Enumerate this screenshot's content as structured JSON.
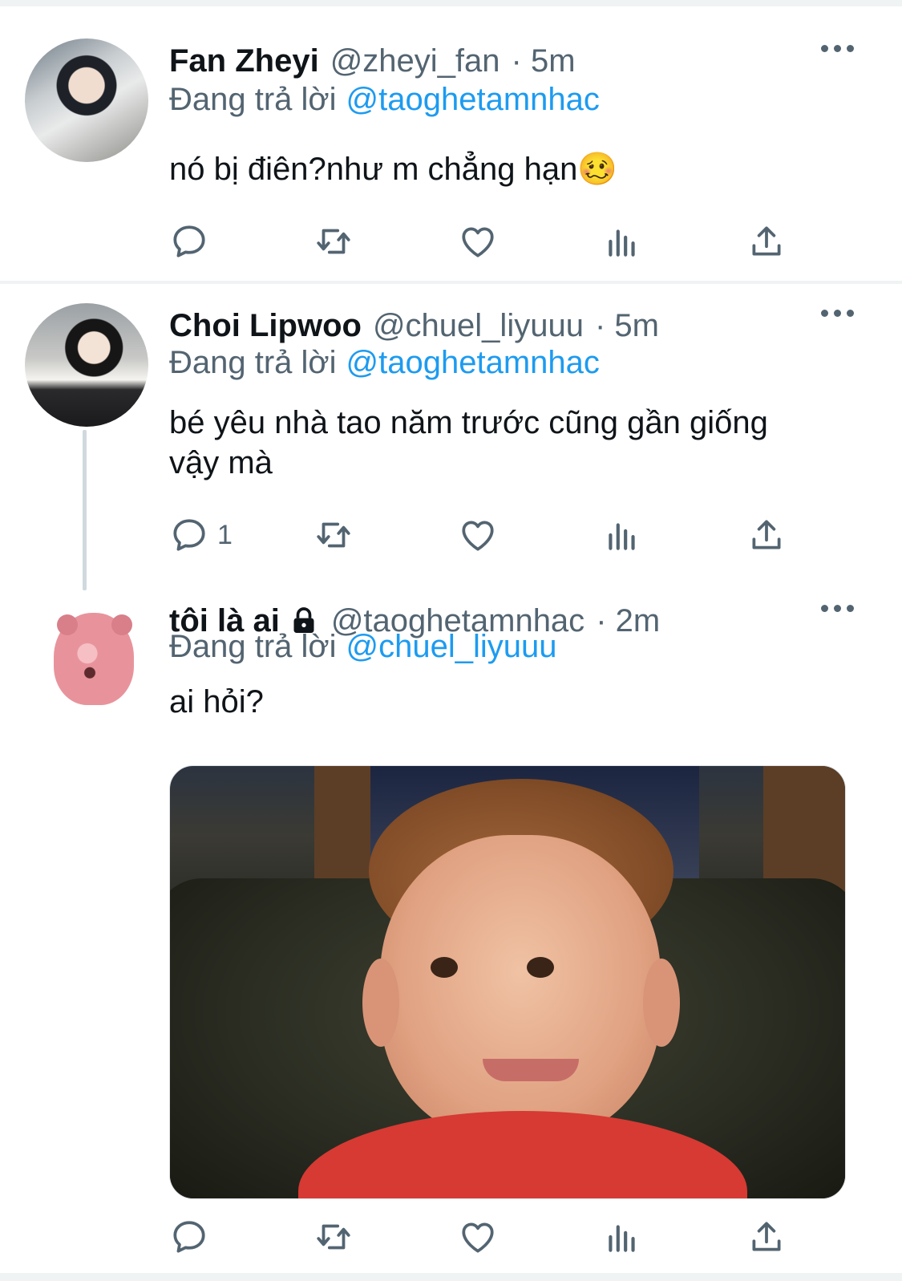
{
  "tweets": [
    {
      "name": "Fan Zheyi",
      "handle": "@zheyi_fan",
      "time": "· 5m",
      "reply_prefix": "Đang trả lời",
      "reply_to": "@taoghetamnhac",
      "text": "nó bị điên?như m chẳng hạn🥴",
      "reply_count": "",
      "avatar_icon": "avatar-photo"
    },
    {
      "name": "Choi Lipwoo",
      "handle": "@chuel_liyuuu",
      "time": "· 5m",
      "reply_prefix": "Đang trả lời",
      "reply_to": "@taoghetamnhac",
      "text_line1": "bé yêu nhà tao năm trước cũng gần giống",
      "text_line2": "vậy mà",
      "reply_count": "1",
      "avatar_icon": "avatar-photo"
    },
    {
      "name": "tôi là ai",
      "locked": true,
      "handle": "@taoghetamnhac",
      "time": "· 2m",
      "reply_prefix": "Đang trả lời",
      "reply_to": "@chuel_liyuuu",
      "text": "ai hỏi?",
      "reply_count": "",
      "avatar_icon": "pink-beaver-avatar",
      "has_media": true
    }
  ],
  "action_icons": [
    "reply-icon",
    "retweet-icon",
    "like-icon",
    "analytics-icon",
    "share-icon"
  ],
  "colors": {
    "text": "#0f1419",
    "secondary": "#536471",
    "link": "#1d9bf0",
    "divider": "#eff3f4"
  }
}
